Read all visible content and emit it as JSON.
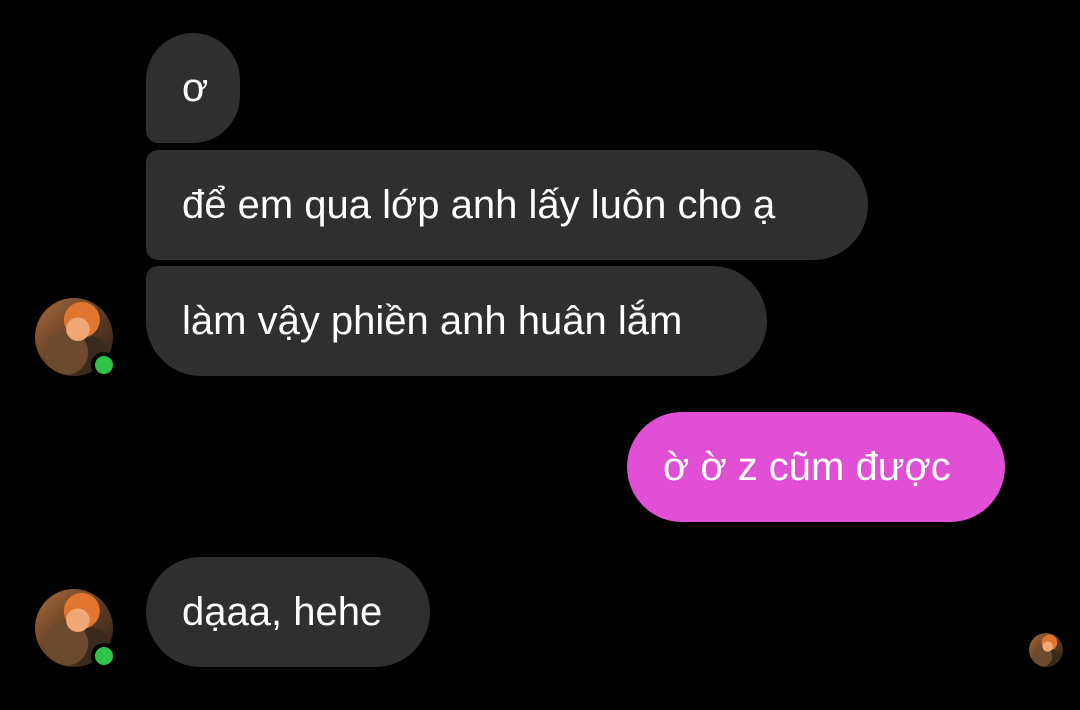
{
  "conversation": {
    "messages": [
      {
        "sender": "other",
        "text": "ơ"
      },
      {
        "sender": "other",
        "text": "để em qua lớp anh lấy luôn cho ạ"
      },
      {
        "sender": "other",
        "text": "làm vậy phiền anh huân lắm"
      },
      {
        "sender": "me",
        "text": "ờ ờ z cũm được"
      },
      {
        "sender": "other",
        "text": "dạaa, hehe"
      }
    ]
  },
  "colors": {
    "background": "#000000",
    "received_bubble": "#2f2f2f",
    "sent_bubble": "#e14fd5",
    "online_indicator": "#31c24a"
  },
  "icons": {
    "contact_avatar": "avatar-photo",
    "online_status": "online-dot",
    "read_receipt": "avatar-photo-small"
  }
}
